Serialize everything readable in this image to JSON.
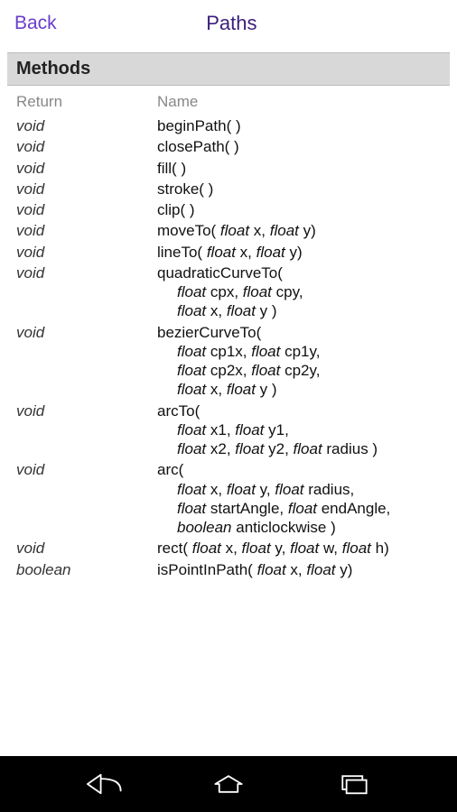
{
  "header": {
    "back_label": "Back",
    "title": "Paths"
  },
  "section_title": "Methods",
  "columns": {
    "return": "Return",
    "name": "Name"
  },
  "rows": [
    {
      "ret": "void",
      "sig": [
        {
          "t": "beginPath( )",
          "i": false
        }
      ]
    },
    {
      "ret": "void",
      "sig": [
        {
          "t": "closePath( )",
          "i": false
        }
      ]
    },
    {
      "ret": "void",
      "sig": [
        {
          "t": "fill( )",
          "i": false
        }
      ]
    },
    {
      "ret": "void",
      "sig": [
        {
          "t": "stroke( )",
          "i": false
        }
      ]
    },
    {
      "ret": "void",
      "sig": [
        {
          "t": "clip( )",
          "i": false
        }
      ]
    },
    {
      "ret": "void",
      "sig": [
        {
          "t": "moveTo( ",
          "i": false
        },
        {
          "t": "float ",
          "i": true
        },
        {
          "t": "x, ",
          "i": false
        },
        {
          "t": "float ",
          "i": true
        },
        {
          "t": "y)",
          "i": false
        }
      ]
    },
    {
      "ret": "void",
      "sig": [
        {
          "t": "lineTo( ",
          "i": false
        },
        {
          "t": "float ",
          "i": true
        },
        {
          "t": "x, ",
          "i": false
        },
        {
          "t": "float ",
          "i": true
        },
        {
          "t": "y)",
          "i": false
        }
      ]
    },
    {
      "ret": "void",
      "sig": [
        {
          "t": "quadraticCurveTo(",
          "i": false
        }
      ],
      "extra": [
        [
          {
            "t": "float ",
            "i": true
          },
          {
            "t": "cpx, ",
            "i": false
          },
          {
            "t": "float ",
            "i": true
          },
          {
            "t": "cpy,",
            "i": false
          }
        ],
        [
          {
            "t": "float ",
            "i": true
          },
          {
            "t": "x, ",
            "i": false
          },
          {
            "t": "float ",
            "i": true
          },
          {
            "t": "y )",
            "i": false
          }
        ]
      ]
    },
    {
      "ret": "void",
      "sig": [
        {
          "t": "bezierCurveTo(",
          "i": false
        }
      ],
      "extra": [
        [
          {
            "t": "float ",
            "i": true
          },
          {
            "t": "cp1x, ",
            "i": false
          },
          {
            "t": "float ",
            "i": true
          },
          {
            "t": "cp1y,",
            "i": false
          }
        ],
        [
          {
            "t": "float ",
            "i": true
          },
          {
            "t": "cp2x, ",
            "i": false
          },
          {
            "t": "float ",
            "i": true
          },
          {
            "t": "cp2y,",
            "i": false
          }
        ],
        [
          {
            "t": "float ",
            "i": true
          },
          {
            "t": "x, ",
            "i": false
          },
          {
            "t": "float ",
            "i": true
          },
          {
            "t": "y )",
            "i": false
          }
        ]
      ]
    },
    {
      "ret": "void",
      "sig": [
        {
          "t": "arcTo(",
          "i": false
        }
      ],
      "extra": [
        [
          {
            "t": "float ",
            "i": true
          },
          {
            "t": "x1, ",
            "i": false
          },
          {
            "t": "float ",
            "i": true
          },
          {
            "t": "y1,",
            "i": false
          }
        ],
        [
          {
            "t": "float ",
            "i": true
          },
          {
            "t": "x2, ",
            "i": false
          },
          {
            "t": "float ",
            "i": true
          },
          {
            "t": "y2, ",
            "i": false
          },
          {
            "t": "float ",
            "i": true
          },
          {
            "t": "radius )",
            "i": false
          }
        ]
      ]
    },
    {
      "ret": "void",
      "sig": [
        {
          "t": "arc(",
          "i": false
        }
      ],
      "extra": [
        [
          {
            "t": "float ",
            "i": true
          },
          {
            "t": "x, ",
            "i": false
          },
          {
            "t": "float ",
            "i": true
          },
          {
            "t": "y, ",
            "i": false
          },
          {
            "t": "float ",
            "i": true
          },
          {
            "t": "radius,",
            "i": false
          }
        ],
        [
          {
            "t": "float ",
            "i": true
          },
          {
            "t": "startAngle, ",
            "i": false
          },
          {
            "t": "float ",
            "i": true
          },
          {
            "t": "endAngle,",
            "i": false
          }
        ],
        [
          {
            "t": "boolean ",
            "i": true
          },
          {
            "t": "anticlockwise )",
            "i": false
          }
        ]
      ]
    },
    {
      "ret": "void",
      "sig": [
        {
          "t": "rect( ",
          "i": false
        },
        {
          "t": "float ",
          "i": true
        },
        {
          "t": "x, ",
          "i": false
        },
        {
          "t": "float ",
          "i": true
        },
        {
          "t": "y, ",
          "i": false
        },
        {
          "t": "float ",
          "i": true
        },
        {
          "t": "w, ",
          "i": false
        },
        {
          "t": "float ",
          "i": true
        },
        {
          "t": "h)",
          "i": false
        }
      ]
    },
    {
      "ret": "boolean",
      "sig": [
        {
          "t": "isPointInPath( ",
          "i": false
        },
        {
          "t": "float ",
          "i": true
        },
        {
          "t": "x, ",
          "i": false
        },
        {
          "t": "float ",
          "i": true
        },
        {
          "t": "y)",
          "i": false
        }
      ]
    }
  ]
}
